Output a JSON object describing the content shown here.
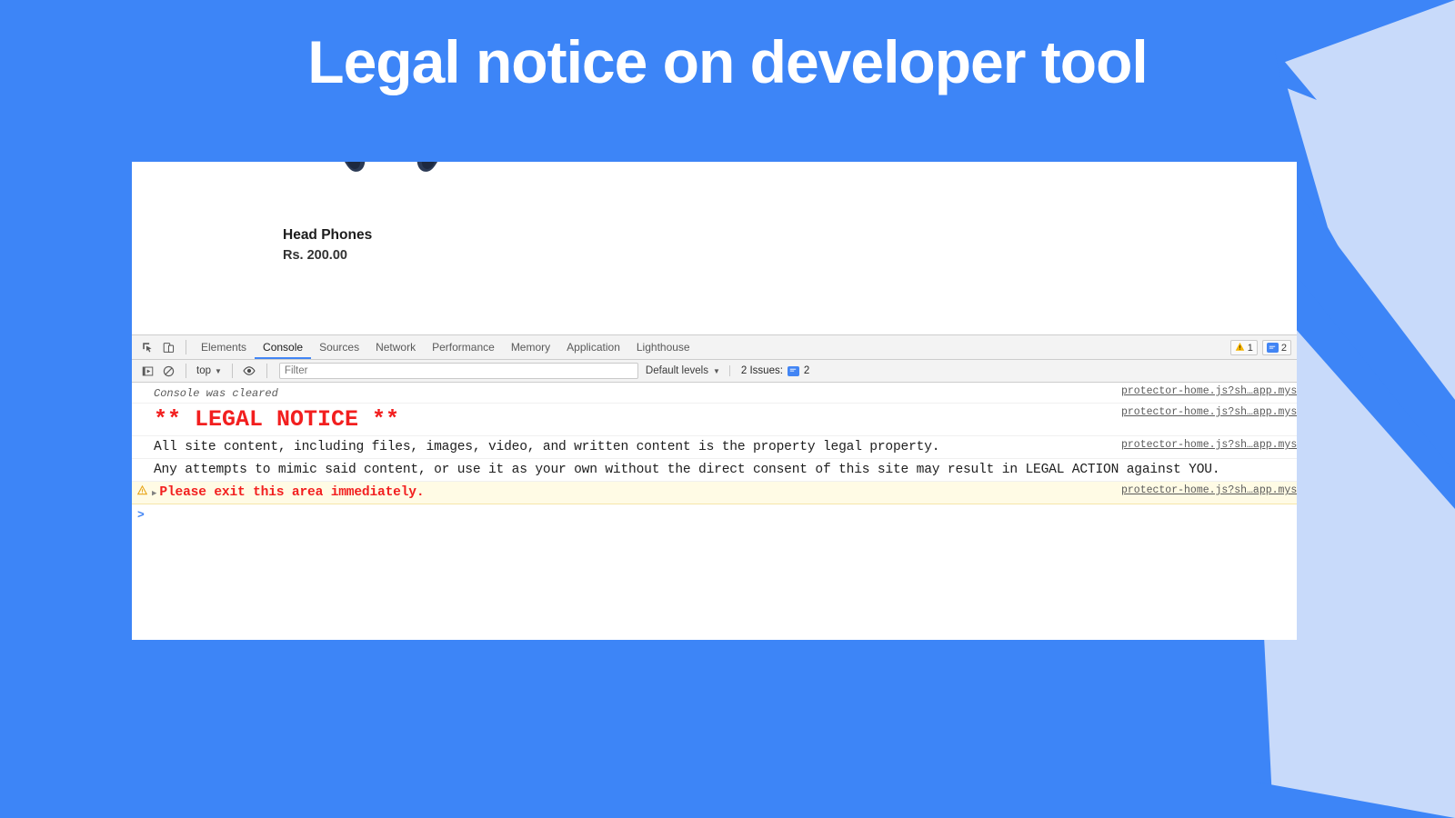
{
  "slide": {
    "title": "Legal notice on developer tool",
    "background_color": "#3d85f7",
    "accent_color": "#c8dafa"
  },
  "product": {
    "name": "Head Phones",
    "price": "Rs. 200.00",
    "image_alt": "headphones-product-image"
  },
  "devtools": {
    "tabs": [
      {
        "label": "Elements",
        "active": false
      },
      {
        "label": "Console",
        "active": true
      },
      {
        "label": "Sources",
        "active": false
      },
      {
        "label": "Network",
        "active": false
      },
      {
        "label": "Performance",
        "active": false
      },
      {
        "label": "Memory",
        "active": false
      },
      {
        "label": "Application",
        "active": false
      },
      {
        "label": "Lighthouse",
        "active": false
      }
    ],
    "toolbar_icons": {
      "inspect": "inspect-element-icon",
      "device": "device-toolbar-icon"
    },
    "status": {
      "warning_count": "1",
      "message_count": "2"
    },
    "filterbar": {
      "execute_icon": "execute-context-icon",
      "clear_icon": "clear-console-icon",
      "context": "top",
      "eye_icon": "live-expression-eye-icon",
      "filter_placeholder": "Filter",
      "filter_value": "",
      "levels": "Default levels",
      "issues_label": "2 Issues:",
      "issues_count": "2"
    },
    "messages": [
      {
        "type": "info",
        "text": "Console was cleared",
        "source": "protector-home.js?sh…app.mysho",
        "style": "cleared"
      },
      {
        "type": "log",
        "text": "** LEGAL NOTICE **",
        "source": "protector-home.js?sh…app.mysho",
        "style": "notice"
      },
      {
        "type": "log",
        "text": "All site content, including files, images, video, and written content is the property legal property.",
        "source": "protector-home.js?sh…app.mysho",
        "style": "body"
      },
      {
        "type": "log",
        "text": "Any attempts to mimic said content, or use it as your own without the direct consent of this site may result in LEGAL ACTION against YOU.",
        "source": "",
        "style": "body"
      },
      {
        "type": "warning",
        "text": "Please exit this area immediately.",
        "source": "protector-home.js?sh…app.mysho",
        "style": "warn"
      }
    ],
    "prompt": ">"
  }
}
